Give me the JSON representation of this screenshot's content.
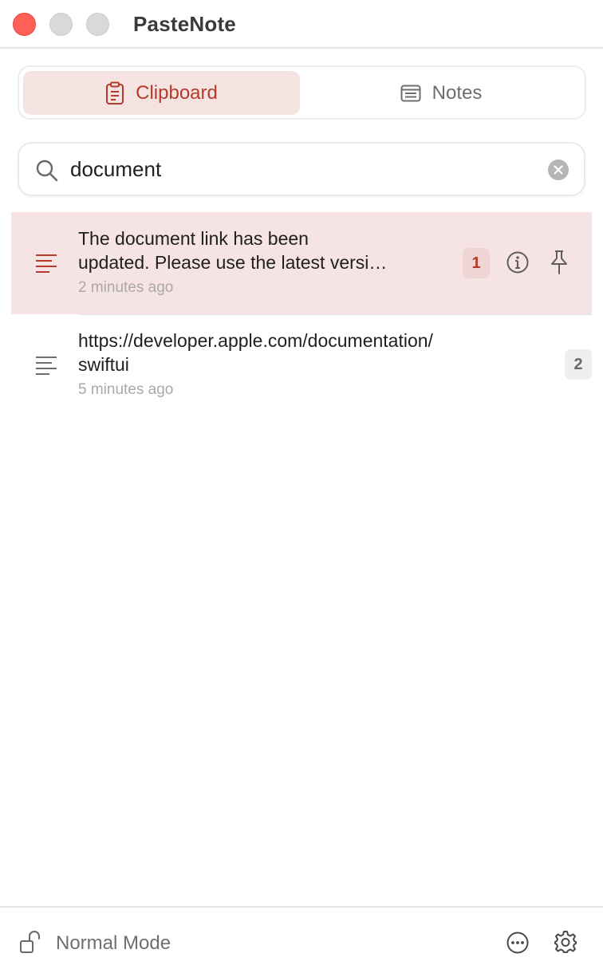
{
  "window": {
    "title": "PasteNote"
  },
  "tabs": [
    {
      "label": "Clipboard",
      "icon": "clipboard-icon",
      "active": true
    },
    {
      "label": "Notes",
      "icon": "note-icon",
      "active": false
    }
  ],
  "search": {
    "value": "document",
    "placeholder": ""
  },
  "clips": [
    {
      "text_line1": "The document link has been",
      "text_line2": "updated. Please use the latest versi…",
      "time": "2 minutes ago",
      "badge": "1",
      "selected": true
    },
    {
      "text_line1": "https://developer.apple.com/documentation/",
      "text_line2": "swiftui",
      "time": "5 minutes ago",
      "badge": "2",
      "selected": false
    }
  ],
  "footer": {
    "mode_label": "Normal Mode"
  },
  "colors": {
    "accent": "#b63a2c",
    "selection_bg": "#f5e4e3",
    "close_light": "#fe5f57"
  }
}
